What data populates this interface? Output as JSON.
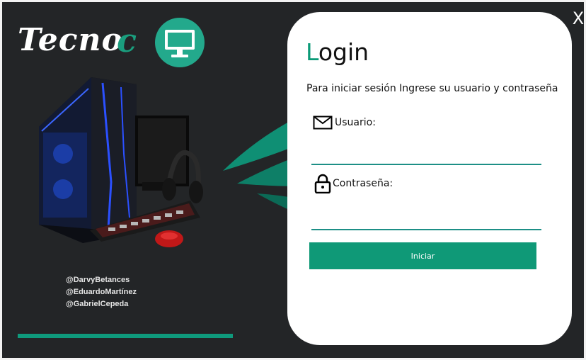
{
  "window": {
    "close_label": "X"
  },
  "brand": {
    "word": "Tecno",
    "letter": "c",
    "icon": "monitor-icon",
    "accent_color": "#1a9e7e"
  },
  "illustration": {
    "icon": "gaming-pc-illustration"
  },
  "credits": [
    "@DarvyBetances",
    "@EduardoMartínez",
    "@GabrielCepeda"
  ],
  "login": {
    "title_first": "L",
    "title_rest": "ogin",
    "subtitle": "Para iniciar sesión Ingrese su usuario y contraseña",
    "user_label": "Usuario:",
    "user_icon": "envelope-icon",
    "user_value": "",
    "password_label": "Contraseña:",
    "password_icon": "lock-icon",
    "password_value": "",
    "submit_label": "Iniciar"
  },
  "colors": {
    "accent": "#0f9977",
    "background": "#232527",
    "card": "#ffffff"
  }
}
